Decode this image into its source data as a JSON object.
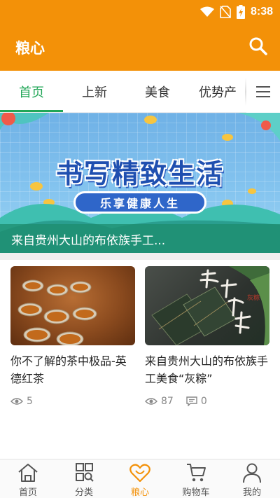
{
  "status_bar": {
    "time": "8:38"
  },
  "app_bar": {
    "title": "粮心"
  },
  "tabs": [
    {
      "label": "首页",
      "active": true
    },
    {
      "label": "上新",
      "active": false
    },
    {
      "label": "美食",
      "active": false
    },
    {
      "label": "优势产",
      "active": false
    }
  ],
  "banner": {
    "headline": "书写精致生活",
    "subheadline": "乐享健康人生",
    "caption": "来自贵州大山的布依族手工..."
  },
  "cards": [
    {
      "title": "你不了解的茶中极品-英德红茶",
      "views": "5",
      "comments": null
    },
    {
      "title": "来自贵州大山的布依族手工美食“灰粽”",
      "views": "87",
      "comments": "0",
      "image_text": "灰粽"
    }
  ],
  "bottom_nav": [
    {
      "label": "首页",
      "icon": "home-icon",
      "active": false
    },
    {
      "label": "分类",
      "icon": "category-icon",
      "active": false
    },
    {
      "label": "粮心",
      "icon": "heart-icon",
      "active": true
    },
    {
      "label": "购物车",
      "icon": "cart-icon",
      "active": false
    },
    {
      "label": "我的",
      "icon": "user-icon",
      "active": false
    }
  ],
  "colors": {
    "primary": "#f39108",
    "tab_active": "#21a657"
  }
}
